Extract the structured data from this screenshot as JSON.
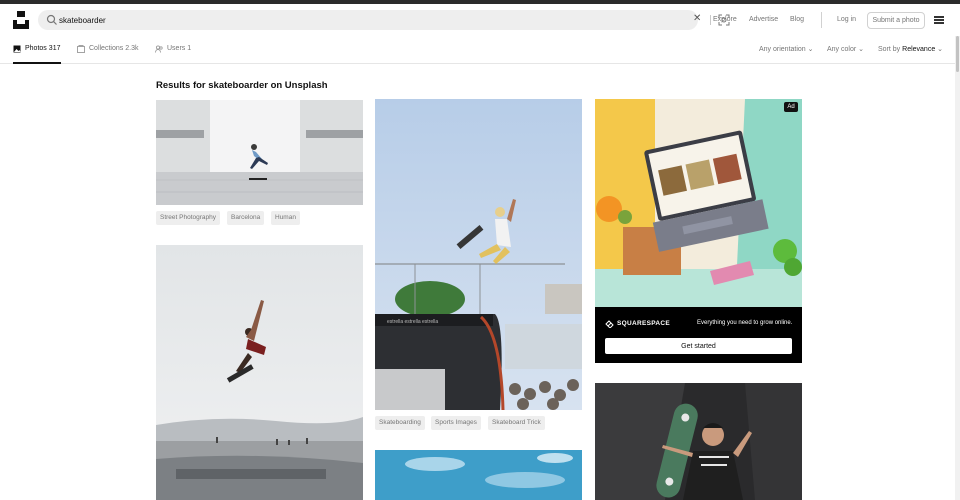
{
  "search": {
    "value": "skateboarder"
  },
  "nav": {
    "explore": "Explore",
    "advertise": "Advertise",
    "blog": "Blog",
    "login": "Log in",
    "submit": "Submit a photo"
  },
  "tabs": [
    {
      "label": "Photos",
      "count": "317"
    },
    {
      "label": "Collections",
      "count": "2.3k"
    },
    {
      "label": "Users",
      "count": "1"
    }
  ],
  "filters": {
    "orientation": "Any orientation",
    "color": "Any color",
    "sort_prefix": "Sort by",
    "sort_value": "Relevance"
  },
  "results_title": "Results for skateboarder on Unsplash",
  "columns": {
    "col1": {
      "photo1_tags": [
        "Street Photography",
        "Barcelona",
        "Human"
      ]
    },
    "col2": {
      "photo1_tags": [
        "Skateboarding",
        "Sports Images",
        "Skateboard Trick"
      ]
    }
  },
  "ad": {
    "badge": "Ad",
    "brand": "SQUARESPACE",
    "tagline": "Everything you need to grow online.",
    "cta": "Get started"
  },
  "colors": {
    "accent": "#111111",
    "muted": "#767676",
    "tag_bg": "#eeeeee",
    "search_bg": "#eeeeee"
  }
}
